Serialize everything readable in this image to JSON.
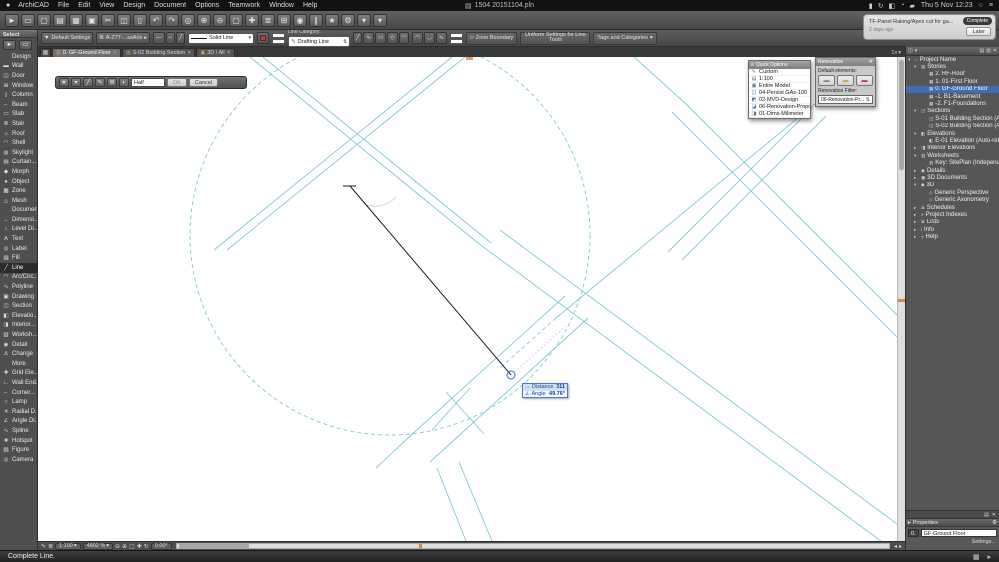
{
  "menubar": {
    "apple_glyph": "●",
    "items": [
      "ArchiCAD",
      "File",
      "Edit",
      "View",
      "Design",
      "Document",
      "Options",
      "Teamwork",
      "Window",
      "Help"
    ],
    "doc_icon": "▤",
    "title": "1504 20151104.pln",
    "status_icons": [
      {
        "name": "display-icon",
        "glyph": "▮"
      },
      {
        "name": "time-machine-icon",
        "glyph": "↻"
      },
      {
        "name": "bluetooth-icon",
        "glyph": "◧"
      },
      {
        "name": "wifi-icon",
        "glyph": "◔"
      },
      {
        "name": "battery-icon",
        "glyph": "▰"
      }
    ],
    "clock": "Thu 5 Nov 12:23",
    "spotlight_glyph": "○",
    "notification_center_glyph": "≡"
  },
  "toolbar": {
    "icons": [
      {
        "name": "pointer-icon",
        "glyph": "►"
      },
      {
        "name": "marquee-icon",
        "glyph": "▭"
      },
      {
        "name": "new-file-icon",
        "glyph": "▢"
      },
      {
        "name": "open-file-icon",
        "glyph": "▤"
      },
      {
        "name": "save-icon",
        "glyph": "▦"
      },
      {
        "name": "print-icon",
        "glyph": "▣"
      },
      {
        "name": "cut-icon",
        "glyph": "✂"
      },
      {
        "name": "copy-icon",
        "glyph": "◫"
      },
      {
        "name": "paste-icon",
        "glyph": "▯"
      },
      {
        "name": "undo-icon",
        "glyph": "↶"
      },
      {
        "name": "redo-icon",
        "glyph": "↷"
      },
      {
        "name": "find-select-icon",
        "glyph": "◎"
      },
      {
        "name": "zoom-in-icon",
        "glyph": "⊕"
      },
      {
        "name": "zoom-out-icon",
        "glyph": "⊖"
      },
      {
        "name": "fit-in-window-icon",
        "glyph": "▢"
      },
      {
        "name": "pan-icon",
        "glyph": "✚"
      },
      {
        "name": "layers-icon",
        "glyph": "≣"
      },
      {
        "name": "grid-snap-icon",
        "glyph": "⊞"
      },
      {
        "name": "gravity-icon",
        "glyph": "◉"
      },
      {
        "name": "guide-lines-icon",
        "glyph": "∥"
      },
      {
        "name": "favorites-icon",
        "glyph": "★"
      },
      {
        "name": "options-icon",
        "glyph": "⚙"
      },
      {
        "name": "view-dropdown-icon",
        "glyph": "▾"
      },
      {
        "name": "more-tools-icon",
        "glyph": "▾"
      }
    ]
  },
  "infobox": {
    "tool_default_glyph": "▼",
    "default_settings": "Default Settings",
    "pencil_glyph": "✎",
    "layer_glyph": "≣",
    "layer": "A-Z77-...ssAris",
    "line_style_icons": [
      {
        "name": "line-weight-icon",
        "glyph": "—"
      },
      {
        "name": "dash-style-icon",
        "glyph": "┄"
      },
      {
        "name": "pen-style-icon",
        "glyph": "╱"
      }
    ],
    "line_type": "Solid Line",
    "line_category_label": "Line Category:",
    "line_category_value": "Drafting Line",
    "geom_icons": [
      {
        "name": "single-line-icon",
        "glyph": "╱"
      },
      {
        "name": "chained-line-icon",
        "glyph": "∿"
      },
      {
        "name": "rectangle-icon",
        "glyph": "▭"
      },
      {
        "name": "rotated-rectangle-icon",
        "glyph": "◇"
      },
      {
        "name": "arc-icon",
        "glyph": "◠"
      }
    ],
    "arc_icons": [
      {
        "name": "center-arc-icon",
        "glyph": "◠"
      },
      {
        "name": "tangent-arc-icon",
        "glyph": "◡"
      },
      {
        "name": "spline-icon",
        "glyph": "∿"
      }
    ],
    "zone_glyph": "▱",
    "zone_boundary": "Zone Boundary",
    "uniform_settings": "Uniform Settings for Line Tools",
    "tags_categories": "Tags and Categories"
  },
  "tabs": {
    "grid_glyph": "▦",
    "items": [
      {
        "icon": "▥",
        "label": "0. GF-Ground Floor",
        "close": "✕",
        "flags": [
          "active"
        ]
      },
      {
        "icon": "▥",
        "label": "S-02 Building Section",
        "close": "✕",
        "flags": []
      },
      {
        "icon": "▣",
        "label": "3D / All",
        "close": "✕",
        "flags": []
      }
    ],
    "overflow": "1x",
    "overflow_caret": "▾"
  },
  "toolbox": {
    "select_header": "Select",
    "select_tools": [
      {
        "name": "arrow-tool-icon",
        "glyph": "►"
      },
      {
        "name": "marquee-tool-icon",
        "glyph": "▭"
      }
    ],
    "rows": [
      {
        "t": "header",
        "label": "Design",
        "flags": [
          "hdr"
        ]
      },
      {
        "icon": "▬",
        "label": "Wall",
        "flags": []
      },
      {
        "icon": "◫",
        "label": "Door",
        "flags": []
      },
      {
        "icon": "⊞",
        "label": "Window",
        "flags": []
      },
      {
        "icon": "▯",
        "label": "Column",
        "flags": []
      },
      {
        "icon": "⌐",
        "label": "Beam",
        "flags": []
      },
      {
        "icon": "▭",
        "label": "Slab",
        "flags": []
      },
      {
        "icon": "≣",
        "label": "Stair",
        "flags": []
      },
      {
        "icon": "⌂",
        "label": "Roof",
        "flags": []
      },
      {
        "icon": "◠",
        "label": "Shell",
        "flags": []
      },
      {
        "icon": "◍",
        "label": "Skylight",
        "flags": []
      },
      {
        "icon": "▤",
        "label": "Curtain...",
        "flags": []
      },
      {
        "icon": "◆",
        "label": "Morph",
        "flags": []
      },
      {
        "icon": "●",
        "label": "Object",
        "flags": []
      },
      {
        "icon": "▩",
        "label": "Zone",
        "flags": []
      },
      {
        "icon": "△",
        "label": "Mesh",
        "flags": []
      },
      {
        "t": "header",
        "label": "Document",
        "flags": [
          "hdr"
        ]
      },
      {
        "icon": "↔",
        "label": "Dimensi...",
        "flags": []
      },
      {
        "icon": "↕",
        "label": "Level Di...",
        "flags": []
      },
      {
        "icon": "A",
        "label": "Text",
        "flags": []
      },
      {
        "icon": "◎",
        "label": "Label",
        "flags": []
      },
      {
        "icon": "▨",
        "label": "Fill",
        "flags": []
      },
      {
        "icon": "╱",
        "label": "Line",
        "flags": [
          "selected"
        ]
      },
      {
        "icon": "◠",
        "label": "Arc/Circ...",
        "flags": []
      },
      {
        "icon": "∿",
        "label": "Polyline",
        "flags": []
      },
      {
        "icon": "▣",
        "label": "Drawing",
        "flags": []
      },
      {
        "icon": "◫",
        "label": "Section",
        "flags": []
      },
      {
        "icon": "◧",
        "label": "Elevatio...",
        "flags": []
      },
      {
        "icon": "◨",
        "label": "Interior...",
        "flags": []
      },
      {
        "icon": "▥",
        "label": "Worksh...",
        "flags": []
      },
      {
        "icon": "◉",
        "label": "Detail",
        "flags": []
      },
      {
        "icon": "Δ",
        "label": "Change",
        "flags": []
      },
      {
        "t": "header",
        "label": "More",
        "flags": [
          "hdr"
        ]
      },
      {
        "icon": "✚",
        "label": "Grid Ele...",
        "flags": []
      },
      {
        "icon": "∟",
        "label": "Wall End...",
        "flags": []
      },
      {
        "icon": "⌐",
        "label": "Corner...",
        "flags": []
      },
      {
        "icon": "○",
        "label": "Lamp",
        "flags": []
      },
      {
        "icon": "✳",
        "label": "Radial D...",
        "flags": []
      },
      {
        "icon": "∠",
        "label": "Angle Di...",
        "flags": []
      },
      {
        "icon": "∿",
        "label": "Spline",
        "flags": []
      },
      {
        "icon": "✚",
        "label": "Hotspot",
        "flags": []
      },
      {
        "icon": "▧",
        "label": "Figure",
        "flags": []
      },
      {
        "icon": "◎",
        "label": "Camera",
        "flags": []
      }
    ]
  },
  "editbar": {
    "icons": [
      {
        "name": "favorites-icon",
        "glyph": "★"
      },
      {
        "name": "settings-dialog-icon",
        "glyph": "▾"
      },
      {
        "name": "geometry-method-icon",
        "glyph": "╱"
      },
      {
        "name": "pen-color-icon",
        "glyph": "✎"
      },
      {
        "name": "layer-icon",
        "glyph": "≣"
      },
      {
        "name": "more-options-icon",
        "glyph": "◐"
      }
    ],
    "value": "Half",
    "ok": "OK",
    "cancel": "Cancel"
  },
  "quick_options": {
    "title": "Quick Options",
    "grip_glyph": "≡",
    "items": [
      {
        "icon": "✎",
        "label": "Custom",
        "flags": []
      },
      {
        "icon": "▤",
        "label": "1:100",
        "flags": []
      },
      {
        "icon": "▣",
        "label": "Entire Model",
        "flags": []
      },
      {
        "icon": "◫",
        "label": "04-Persist GAs-100",
        "flags": []
      },
      {
        "icon": "◩",
        "label": "02-MVD-Design",
        "flags": []
      },
      {
        "icon": "◪",
        "label": "06-Renovation-Proposed",
        "flags": []
      },
      {
        "icon": "◨",
        "label": "01-Dims-Milimeter",
        "flags": []
      }
    ]
  },
  "renovation": {
    "title": "Renovation",
    "close_glyph": "✕",
    "default_label": "Default elements:",
    "buttons": [
      {
        "name": "existing-elements-button",
        "glyph": "▬",
        "flags": [
          "c-exist"
        ]
      },
      {
        "name": "demolished-elements-button",
        "glyph": "▬",
        "flags": [
          "c-demo"
        ]
      },
      {
        "name": "new-elements-button",
        "glyph": "▬",
        "flags": [
          "c-new"
        ]
      }
    ],
    "filter_label": "Renovation Filter:",
    "filter_value": "06-Renovation-Pr...",
    "stepper_glyph": "⇅"
  },
  "notification": {
    "badge": "Complete",
    "title": "TF-Panel Raking/Apex cut for ga...",
    "time": "2 days ago",
    "later": "Later"
  },
  "navigator": {
    "header_icons_left": [
      {
        "name": "project-chooser-icon",
        "glyph": "◫"
      },
      {
        "name": "map-dropdown-icon",
        "glyph": "▾"
      }
    ],
    "header_icons_right": [
      {
        "name": "tree-view-icon",
        "glyph": "▤"
      },
      {
        "name": "pin-palette-icon",
        "glyph": "▥"
      },
      {
        "name": "close-icon",
        "glyph": "✕"
      }
    ],
    "rows": [
      {
        "arrow": "▾",
        "icon": "⌂",
        "label": "Project Name",
        "flags": [
          "lvl0"
        ]
      },
      {
        "arrow": "▾",
        "icon": "▤",
        "label": "Stories",
        "flags": [
          "lvl1"
        ]
      },
      {
        "arrow": "",
        "icon": "▦",
        "label": "2. RF-Roof",
        "flags": [
          "lvl2"
        ]
      },
      {
        "arrow": "",
        "icon": "▦",
        "label": "1. 01-First Floor",
        "flags": [
          "lvl2"
        ]
      },
      {
        "arrow": "",
        "icon": "▦",
        "label": "0. GF-Ground Floor",
        "flags": [
          "lvl2",
          "selected"
        ]
      },
      {
        "arrow": "",
        "icon": "▦",
        "label": "-1. B1-Basement",
        "flags": [
          "lvl2"
        ]
      },
      {
        "arrow": "",
        "icon": "▦",
        "label": "-2. F1-Foundations",
        "flags": [
          "lvl2"
        ]
      },
      {
        "arrow": "▾",
        "icon": "◫",
        "label": "Sections",
        "flags": [
          "lvl1"
        ]
      },
      {
        "arrow": "",
        "icon": "◫",
        "label": "S-01 Building Section (Auto-re...",
        "flags": [
          "lvl2"
        ]
      },
      {
        "arrow": "",
        "icon": "◫",
        "label": "S-02 Building Section (Auto-re...",
        "flags": [
          "lvl2"
        ]
      },
      {
        "arrow": "▾",
        "icon": "◧",
        "label": "Elevations",
        "flags": [
          "lvl1"
        ]
      },
      {
        "arrow": "",
        "icon": "◧",
        "label": "E-01 Elevation (Auto-rebuild M...",
        "flags": [
          "lvl2"
        ]
      },
      {
        "arrow": "▸",
        "icon": "◨",
        "label": "Interior Elevations",
        "flags": [
          "lvl1"
        ]
      },
      {
        "arrow": "▾",
        "icon": "▥",
        "label": "Worksheets",
        "flags": [
          "lvl1"
        ]
      },
      {
        "arrow": "",
        "icon": "▥",
        "label": "Key: SitePlan (Independent)",
        "flags": [
          "lvl2"
        ]
      },
      {
        "arrow": "▸",
        "icon": "◉",
        "label": "Details",
        "flags": [
          "lvl1"
        ]
      },
      {
        "arrow": "▸",
        "icon": "▣",
        "label": "3D Documents",
        "flags": [
          "lvl1"
        ]
      },
      {
        "arrow": "▾",
        "icon": "◆",
        "label": "3D",
        "flags": [
          "lvl1"
        ]
      },
      {
        "arrow": "",
        "icon": "◇",
        "label": "Generic Perspective",
        "flags": [
          "lvl2"
        ]
      },
      {
        "arrow": "",
        "icon": "◇",
        "label": "Generic Axonometry",
        "flags": [
          "lvl2"
        ]
      },
      {
        "arrow": "▸",
        "icon": "≣",
        "label": "Schedules",
        "flags": [
          "lvl1"
        ]
      },
      {
        "arrow": "▸",
        "icon": "≡",
        "label": "Project Indexes",
        "flags": [
          "lvl1"
        ]
      },
      {
        "arrow": "▸",
        "icon": "≣",
        "label": "Lists",
        "flags": [
          "lvl1"
        ]
      },
      {
        "arrow": "▸",
        "icon": "i",
        "label": "Info",
        "flags": [
          "lvl1"
        ]
      },
      {
        "arrow": "▸",
        "icon": "?",
        "label": "Help",
        "flags": [
          "lvl1"
        ]
      }
    ]
  },
  "nav_minibar_icons": [
    {
      "name": "list-view-icon",
      "glyph": "▤"
    },
    {
      "name": "close-panel-icon",
      "glyph": "✕"
    }
  ],
  "properties": {
    "arrow_glyph": "▸",
    "title": "Properties",
    "gear_glyph": "⚙",
    "index": "0.",
    "value": "GF-Ground Floor",
    "settings": "Settings..."
  },
  "statusbar": {
    "left_icons": [
      {
        "name": "pen-set-icon",
        "glyph": "✎"
      },
      {
        "name": "quick-layers-icon",
        "glyph": "≣"
      }
    ],
    "scale": "1:100",
    "zoom": "4802 %",
    "mid_icons": [
      {
        "name": "zoom-out-icon",
        "glyph": "⊖"
      },
      {
        "name": "zoom-in-icon",
        "glyph": "⊕"
      },
      {
        "name": "fit-view-icon",
        "glyph": "▢"
      },
      {
        "name": "pan-hand-icon",
        "glyph": "✚"
      },
      {
        "name": "orbit-icon",
        "glyph": "↻"
      }
    ],
    "angle": "0.00°",
    "nav_arrows": [
      {
        "name": "scroll-left-icon",
        "glyph": "◂"
      },
      {
        "name": "scroll-right-icon",
        "glyph": "▸"
      }
    ]
  },
  "tracker": {
    "distance_icon": "↔",
    "distance_label": "Distance",
    "distance_value": "311",
    "angle_icon": "∠",
    "angle_label": "Angle",
    "angle_value": "49.76°"
  },
  "message": "Complete Line.",
  "msgbar_icons": [
    {
      "name": "keyboard-shortcut-icon",
      "glyph": "▦"
    },
    {
      "name": "expand-status-icon",
      "glyph": "▸"
    }
  ]
}
